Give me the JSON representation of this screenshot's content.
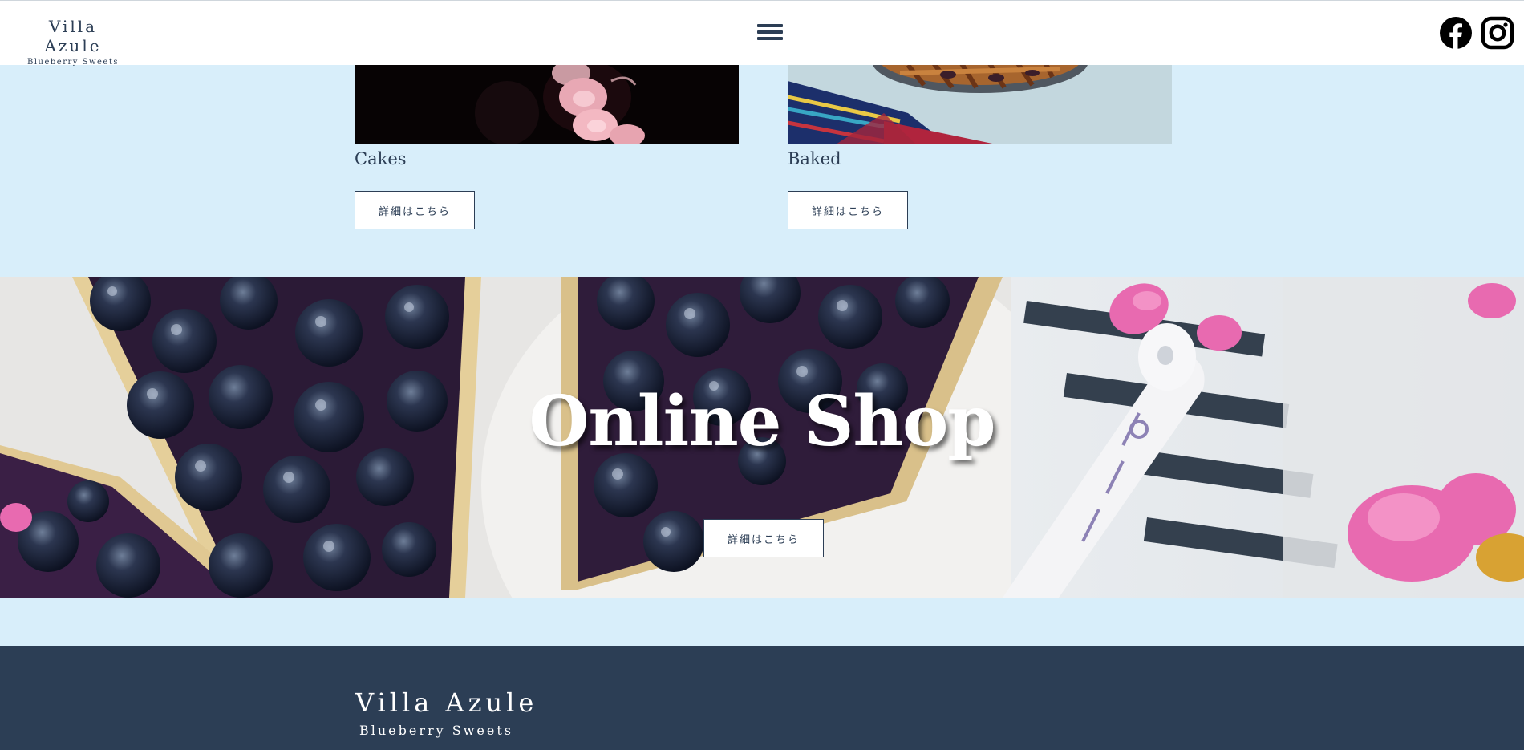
{
  "header": {
    "logo_name": "Villa Azule",
    "logo_tagline": "Blueberry Sweets",
    "menu_icon": "hamburger-menu-icon",
    "social": [
      {
        "icon": "facebook-icon"
      },
      {
        "icon": "instagram-icon"
      }
    ]
  },
  "categories": [
    {
      "title": "Cakes",
      "button_label": "詳細はこちら"
    },
    {
      "title": "Baked",
      "button_label": "詳細はこちら"
    }
  ],
  "banner": {
    "title": "Online Shop",
    "button_label": "詳細はこちら"
  },
  "footer": {
    "logo_name": "Villa Azule",
    "logo_tagline": "Blueberry Sweets"
  },
  "colors": {
    "navy": "#2c3e55",
    "page_background": "#d8eefa",
    "white": "#ffffff"
  }
}
